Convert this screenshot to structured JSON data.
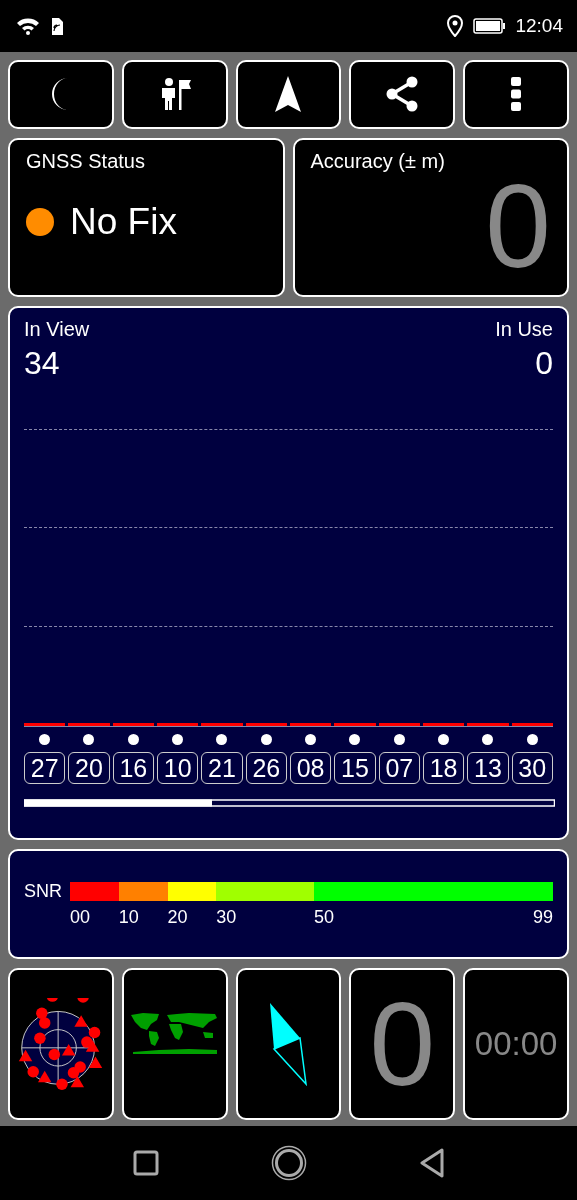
{
  "status_bar": {
    "time": "12:04"
  },
  "toolbar": [
    {
      "kind": "moon"
    },
    {
      "kind": "flag"
    },
    {
      "kind": "navigate"
    },
    {
      "kind": "share"
    },
    {
      "kind": "more"
    }
  ],
  "gnss": {
    "title": "GNSS Status",
    "status": "No Fix",
    "color": "#ff8c00"
  },
  "accuracy": {
    "title": "Accuracy (± m)",
    "value": "0"
  },
  "sky": {
    "in_view_label": "In View",
    "in_view": "34",
    "in_use_label": "In Use",
    "in_use": "0",
    "satellites": [
      {
        "prn": "27"
      },
      {
        "prn": "20"
      },
      {
        "prn": "16"
      },
      {
        "prn": "10"
      },
      {
        "prn": "21"
      },
      {
        "prn": "26"
      },
      {
        "prn": "08"
      },
      {
        "prn": "15"
      },
      {
        "prn": "07"
      },
      {
        "prn": "18"
      },
      {
        "prn": "13"
      },
      {
        "prn": "30"
      }
    ]
  },
  "snr": {
    "label": "SNR",
    "segments": [
      {
        "color": "#ff0000"
      },
      {
        "color": "#ff8000"
      },
      {
        "color": "#ffff00"
      },
      {
        "color": "#a0ff00"
      },
      {
        "color": "#00ff00"
      }
    ],
    "ticks": [
      "00",
      "10",
      "20",
      "30",
      "50",
      "99"
    ]
  },
  "tiles": [
    {
      "kind": "skyplot"
    },
    {
      "kind": "worldmap"
    },
    {
      "kind": "compass"
    },
    {
      "kind": "text",
      "text": "0"
    },
    {
      "kind": "timer",
      "text": "00:00"
    }
  ]
}
